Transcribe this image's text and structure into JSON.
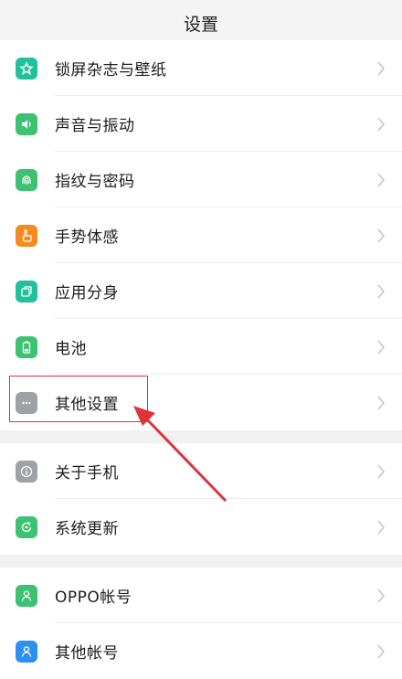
{
  "header": {
    "title": "设置"
  },
  "colors": {
    "green": "#3dc271",
    "teal": "#20c19b",
    "orange": "#f58a1f",
    "gray": "#9ea1a6",
    "blue": "#2f8ff0",
    "annotation_red": "#e0323a"
  },
  "group1": [
    {
      "label": "锁屏杂志与壁纸",
      "icon": "flower-icon"
    },
    {
      "label": "声音与振动",
      "icon": "speaker-icon"
    },
    {
      "label": "指纹与密码",
      "icon": "fingerprint-icon"
    },
    {
      "label": "手势体感",
      "icon": "hand-icon"
    },
    {
      "label": "应用分身",
      "icon": "app-clone-icon"
    },
    {
      "label": "电池",
      "icon": "battery-icon"
    },
    {
      "label": "其他设置",
      "icon": "more-dots-icon"
    }
  ],
  "group2": [
    {
      "label": "关于手机",
      "icon": "info-icon"
    },
    {
      "label": "系统更新",
      "icon": "update-icon"
    }
  ],
  "group3": [
    {
      "label": "OPPO帐号",
      "icon": "user-icon"
    },
    {
      "label": "其他帐号",
      "icon": "account-icon"
    }
  ]
}
